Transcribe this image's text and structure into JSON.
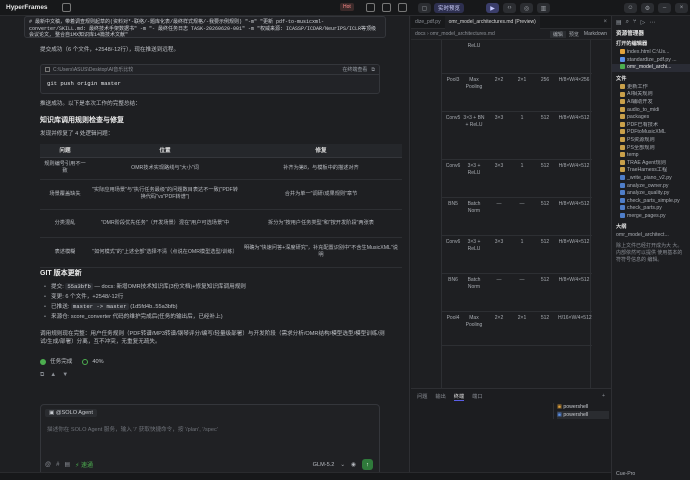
{
  "app": {
    "name": "HyperFrames",
    "hot_badge": "Hot"
  },
  "topbar": {
    "mode_live": "实时预览"
  },
  "chat": {
    "header_text": "# 最新中文稿，带着调查规则起草的(资料对*-联络/-题库化表/最终样式规格/-我要示例规则) \"-m\" \"更新 pdf-to-musicxml-converter/SKILL.md: 最终技术手架数据书\" -m \"- 最终任务日志 TASK-20260620-001\" -m \"权威来源: ICASSP/ICDAR/NeurIPS/ICLR等顶级会议论文, 整合自1MX知识库14篇技术文献\"",
    "commit_success": "提交成功（6 个文件，+2548/-12行），现在推送到远程。",
    "cmd1_path": "C:\\Users\\ASUS\\Desktop\\AI音乐比较",
    "cmd1_action": "在终端查看",
    "cmd1_code": "git push origin master",
    "push_success": "推送成功。以下是本次工作的完整总结：",
    "section1_title": "知识库调用规则检查与修复",
    "found_issues": "发现并修复了 4 处逻辑问题：",
    "table_headers": [
      "问题",
      "位置",
      "修复"
    ],
    "table_rows": [
      [
        "规则编号引用不一致",
        "OMR技术实现路线与\"大小\"词",
        "补齐为第8，与模板中的描述对齐"
      ],
      [
        "场景覆盖缺失",
        "\"实际应用场景\"与\"执行任务最级\"的问题数目表达不一致(\"PDF转换代码\"vs\"PDF转谱\")",
        "合并为单一\"调研/成果规则\"章节"
      ],
      [
        "分类混乱",
        "\"OMR阶段优先任务\"（开发场景）混在\"用户可选场景\"中",
        "拆分为\"按用户任务类型\"和\"按开发阶段\"两张表"
      ],
      [
        "表述模糊",
        "\"如何模式\"的\"上述全部\"选择不清（点说在OMR模型选型/训练）",
        "明确为\"快速问答+深度研究\"，补充配置识别中\"不含生MusicXML\"说明"
      ]
    ],
    "section2_title": "GIT 版本更新",
    "git_items": [
      {
        "label": "提交:",
        "code": "55a3bfb",
        "rest": "— docs: 新增OMR技术知识库(3份文档)+修复知识库调用规则"
      },
      {
        "label": "变更:",
        "code": "",
        "rest": "6 个文件，+2548/-12行"
      },
      {
        "label": "已推送:",
        "code": "master -> master",
        "rest": "(1d5fd4b..55a3bfb)"
      },
      {
        "label": "来源仓:",
        "code": "",
        "rest": "score_converter 代码的维护完成后(任务的输出后，已经补上)"
      }
    ],
    "final_note": "调用规则现在完整：用户任务规则（PDF转谱/MP3转谱/钢琴评分/编写/轻量级部署）与开发阶段（需求分析/OMR结构/模型选型/模型训练/测试/生成/部署）分离，互不冲突，无重复无疏失。",
    "task_status": "任务完成",
    "progress": "40%",
    "agent_name": "@SOLO Agent",
    "input_placeholder": "描述你在 SOLO Agent 服务，输入 '/' 获取快捷命令，按 '/plan', '/spec'",
    "mode_chip": "速通",
    "model": "GLM-5.2"
  },
  "editor": {
    "tabs": [
      "dize_pdf.py",
      "omr_model_architectures.md (Preview)"
    ],
    "breadcrumb": [
      "docs",
      "omr_model_architectures.md",
      "编辑",
      "预览",
      "Markdown"
    ],
    "rows": [
      {
        "h": 34,
        "cells": [
          "",
          "ReLU",
          "",
          "",
          "",
          ""
        ]
      },
      {
        "h": 38,
        "cells": [
          "Pool3",
          "Max Pooling",
          "2×2",
          "2×1",
          "256",
          "H/8×W/4×256"
        ]
      },
      {
        "h": 48,
        "cells": [
          "Conv5",
          "3×3 + BN + ReLU",
          "3×3",
          "1",
          "512",
          "H/8×W/4×512"
        ]
      },
      {
        "h": 38,
        "cells": [
          "Conv6",
          "3×3 + ReLU",
          "3×3",
          "1",
          "512",
          "H/8×W/4×512"
        ]
      },
      {
        "h": 38,
        "cells": [
          "BN5",
          "Batch Norm",
          "—",
          "—",
          "512",
          "H/8×W/4×512"
        ]
      },
      {
        "h": 38,
        "cells": [
          "Conv6",
          "3×3 + ReLU",
          "3×3",
          "1",
          "512",
          "H/8×W/4×512"
        ]
      },
      {
        "h": 38,
        "cells": [
          "BN6",
          "Batch Norm",
          "—",
          "—",
          "512",
          "H/8×W/4×512"
        ]
      },
      {
        "h": 34,
        "cells": [
          "Pool4",
          "Max Pooling",
          "2×2",
          "2×1",
          "512",
          "H/16×W/4×512"
        ]
      }
    ]
  },
  "bottom": {
    "tabs": [
      "问题",
      "输出",
      "终端",
      "端口"
    ],
    "terms": [
      "powershell",
      "powershell"
    ]
  },
  "sidebar": {
    "header": "资源管理器",
    "open_editors": "打开的编辑器",
    "open_files": [
      "index.html C:\\Us...",
      "standardize_pdf.py ...",
      "omr_model_archi..."
    ],
    "files_header": "文件",
    "files": [
      "更新工作",
      "AI相关规则",
      "AI辅助开发",
      "audio_to_midi",
      "packages",
      "PDF已有技术",
      "PDFtoMusicXML",
      "PS资源规则",
      "PS全部规则",
      "temp",
      "TRAE Agent规则",
      "TraeHarness工程",
      "_write_piano_v2.py",
      "analyze_owner.py",
      "analyze_quality.py",
      "check_parts_simple.py",
      "check_parts.py",
      "merge_pages.py"
    ],
    "outline_header": "大纲",
    "outline_file": "omr_model_architect...",
    "outline_body": "除上文件已经打开成为大 大。内部依然可以提供 使用基本的符符号信息的 编辑。",
    "footer": "Cue-Pro"
  },
  "colors": {
    "accent": "#5b5fe8",
    "progress": "#4cae4f"
  }
}
